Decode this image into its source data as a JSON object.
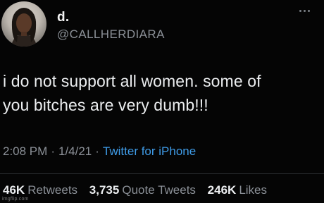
{
  "author": {
    "display_name": "d.",
    "handle": "@CALLHERDIARA"
  },
  "tweet": {
    "text_line1": "i do not support all women. some of",
    "text_line2": "you bitches are very dumb!!!",
    "time": "2:08 PM",
    "date": "1/4/21",
    "separator": "·",
    "source": "Twitter for iPhone"
  },
  "stats": [
    {
      "count": "46K",
      "label": "Retweets"
    },
    {
      "count": "3,735",
      "label": "Quote Tweets"
    },
    {
      "count": "246K",
      "label": "Likes"
    }
  ],
  "watermark": "imgflip.com",
  "icons": {
    "avatar": "avatar-photo",
    "more": "more-options-icon"
  },
  "colors": {
    "background": "#000000",
    "text": "#e7e9ea",
    "secondary": "#8b9097",
    "link": "#3f9ce8"
  }
}
